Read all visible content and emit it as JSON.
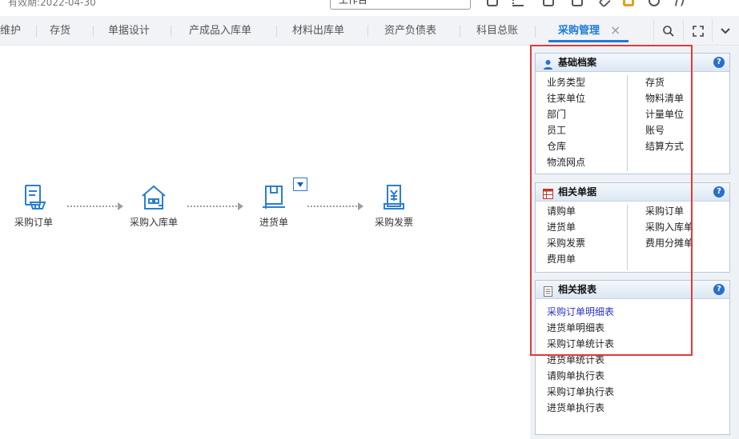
{
  "topbar": {
    "validity_text": "有效期:2022-04-30",
    "input_value": "工作台"
  },
  "tabs": [
    {
      "label": "维护"
    },
    {
      "label": "存货"
    },
    {
      "label": "单据设计"
    },
    {
      "label": "产成品入库单"
    },
    {
      "label": "材料出库单"
    },
    {
      "label": "资产负债表"
    },
    {
      "label": "科目总账"
    },
    {
      "label": "采购管理",
      "active": true
    }
  ],
  "tab_close_symbol": "×",
  "toolbar": {
    "search_icon": "search-icon",
    "fullscreen_icon": "fullscreen-icon",
    "more_icon": "chevron-down-icon"
  },
  "flow": {
    "nodes": [
      {
        "label": "采购订单",
        "icon": "purchase-order-icon"
      },
      {
        "label": "采购入库单",
        "icon": "warehouse-in-icon"
      },
      {
        "label": "进货单",
        "icon": "goods-receipt-icon"
      },
      {
        "label": "采购发票",
        "icon": "invoice-icon"
      }
    ]
  },
  "panels": {
    "basic": {
      "title": "基础档案",
      "left": [
        "业务类型",
        "往来单位",
        "部门",
        "员工",
        "仓库",
        "物流网点"
      ],
      "right": [
        "存货",
        "物料清单",
        "计量单位",
        "账号",
        "结算方式"
      ]
    },
    "docs": {
      "title": "相关单据",
      "left": [
        "请购单",
        "进货单",
        "采购发票",
        "费用单"
      ],
      "right": [
        "采购订单",
        "采购入库单",
        "费用分摊单"
      ]
    },
    "reports": {
      "title": "相关报表",
      "items": [
        "采购订单明细表",
        "进货单明细表",
        "采购订单统计表",
        "进货单统计表",
        "请购单执行表",
        "采购订单执行表",
        "进货单执行表"
      ]
    },
    "help_symbol": "?"
  },
  "colors": {
    "accent": "#1f7bd7",
    "highlight_box": "#e23a3a",
    "link": "#2733c9"
  }
}
